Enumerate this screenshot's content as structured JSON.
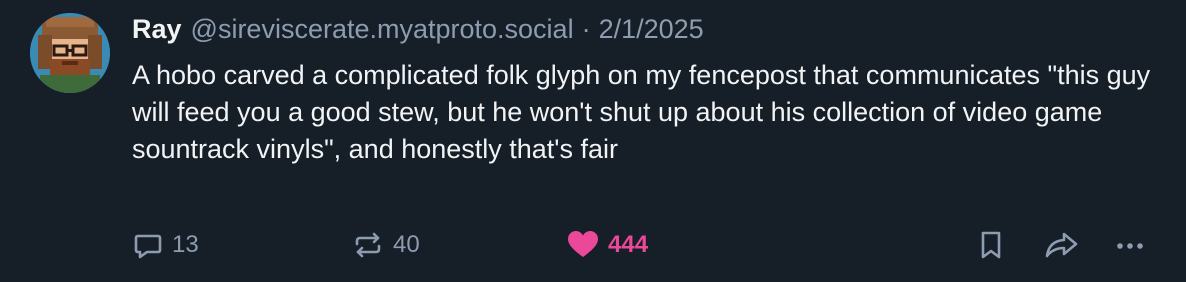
{
  "post": {
    "author_name": "Ray",
    "author_handle": "@sireviscerate.myatproto.social",
    "separator": "·",
    "date": "2/1/2025",
    "text": "A hobo carved a complicated folk glyph on my fencepost that communicates \"this guy will feed you a good stew, but he won't shut up about his collection of video game sountrack vinyls\", and honestly that's fair"
  },
  "actions": {
    "reply_count": "13",
    "repost_count": "40",
    "like_count": "444",
    "liked": true
  },
  "colors": {
    "background": "#161e27",
    "text": "#f1f3f5",
    "muted": "#8d9cb0",
    "like": "#ec4899"
  },
  "icons": [
    "reply-icon",
    "repost-icon",
    "heart-icon",
    "bookmark-icon",
    "share-icon",
    "more-icon"
  ]
}
